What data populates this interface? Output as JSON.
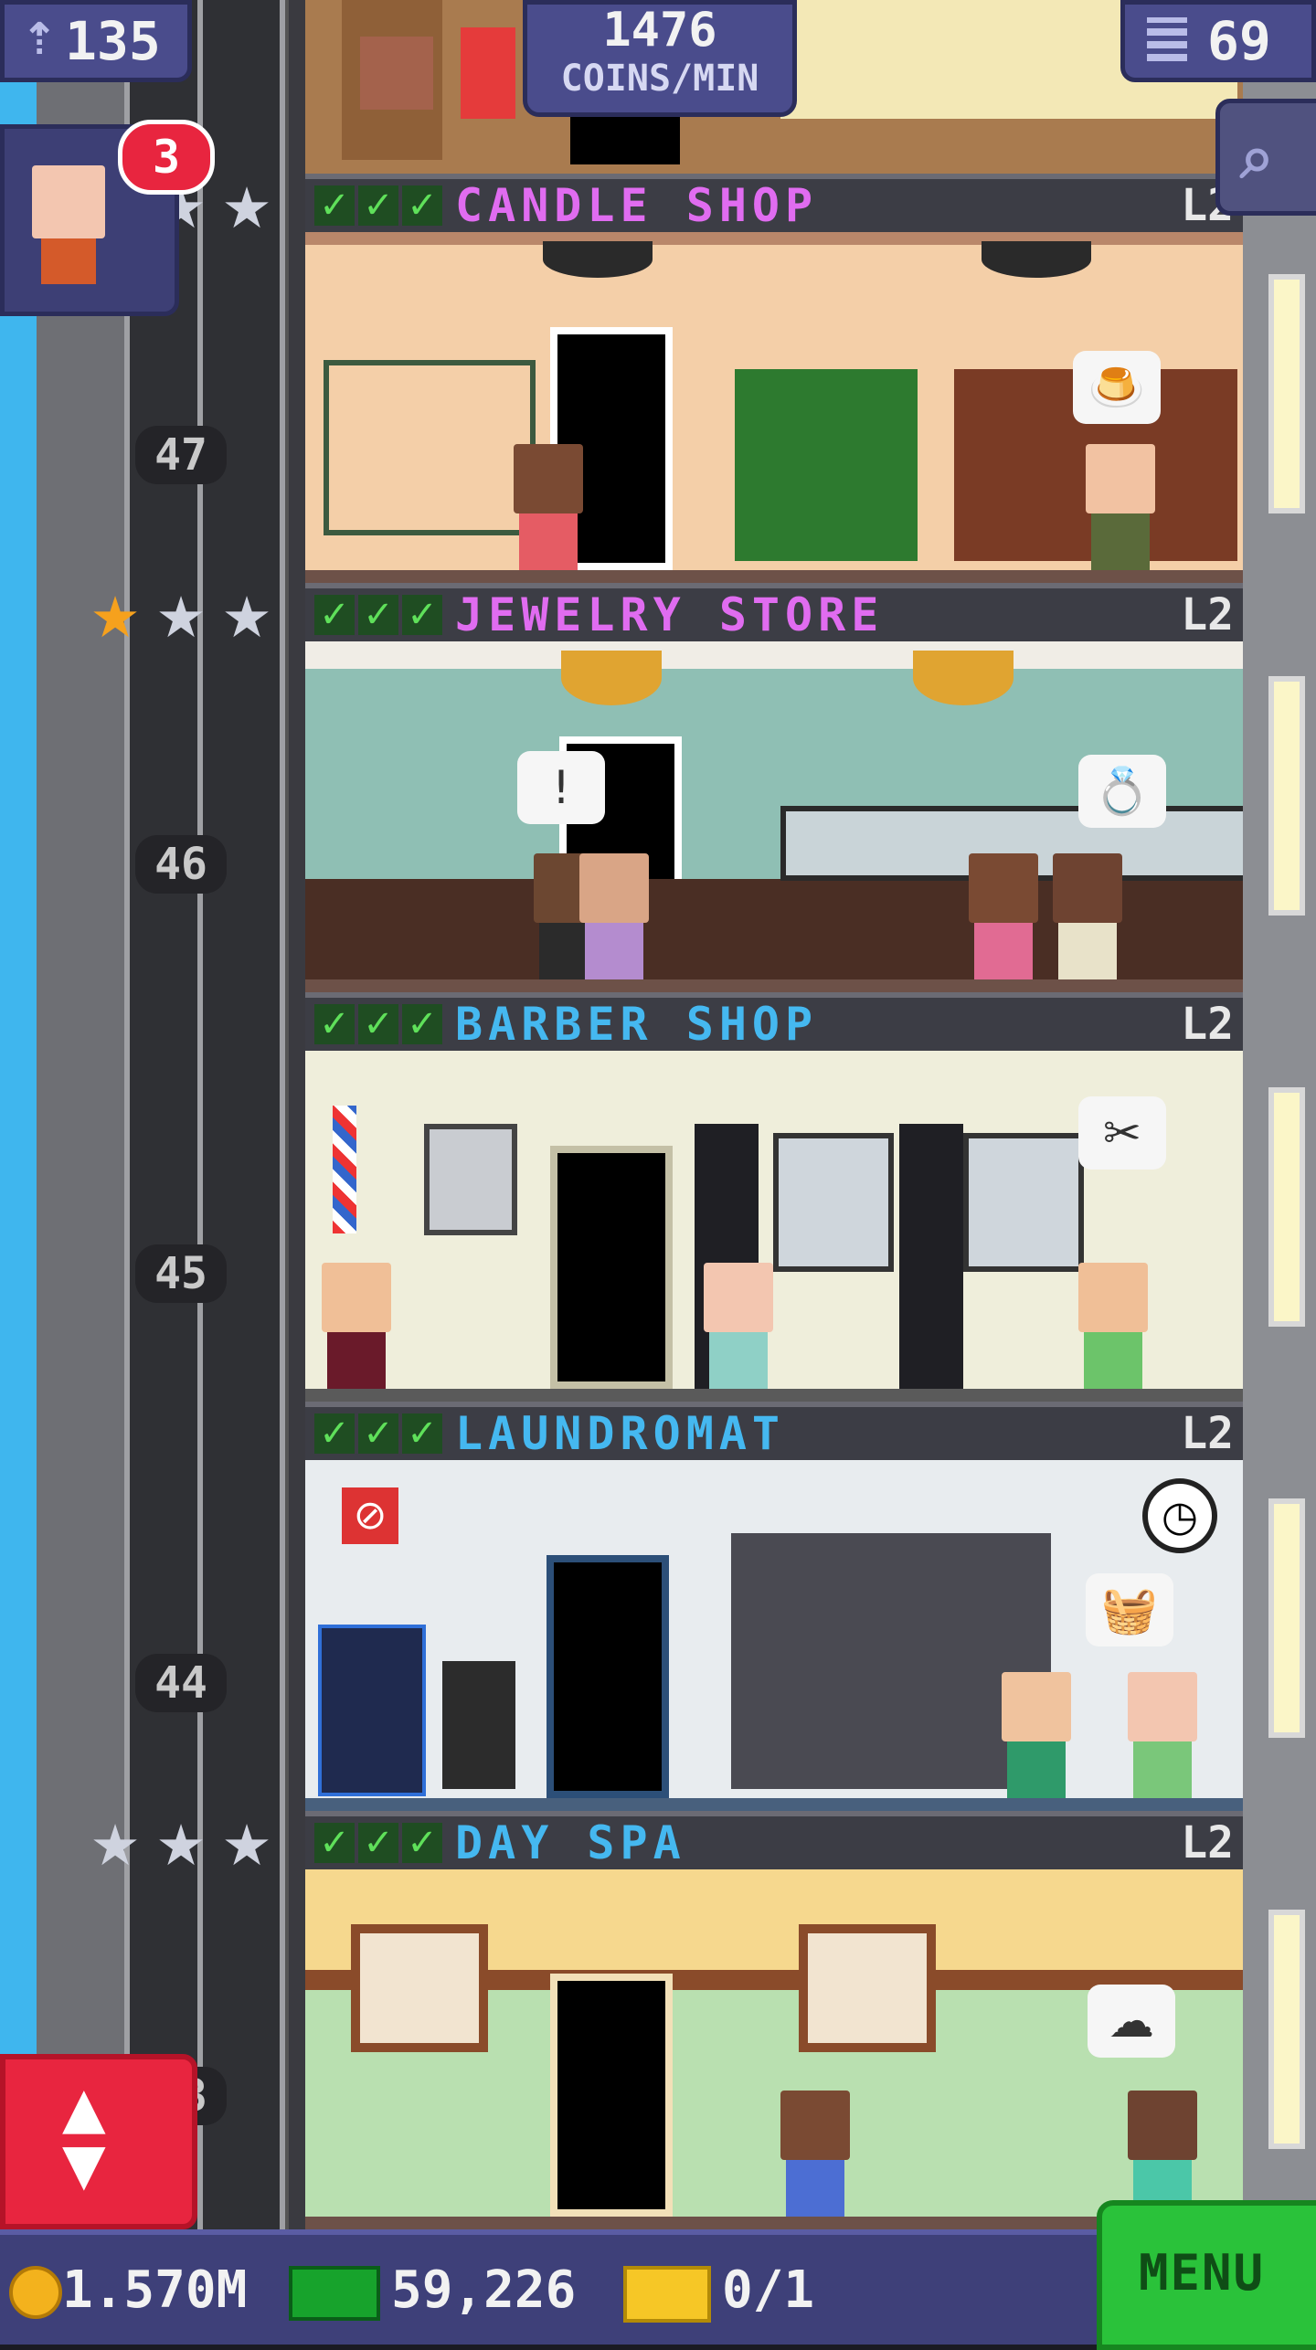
{
  "hud": {
    "population": "135",
    "coins_per_min_value": "1476",
    "coins_per_min_label": "COINS/MIN",
    "floors_count": "69",
    "notification_badge": "3"
  },
  "floors": [
    {
      "name": "CANDLE SHOP",
      "level": "L2",
      "number": "47"
    },
    {
      "name": "JEWELRY STORE",
      "level": "L2",
      "number": "46"
    },
    {
      "name": "BARBER SHOP",
      "level": "L2",
      "number": "45"
    },
    {
      "name": "LAUNDROMAT",
      "level": "L2",
      "number": "44"
    },
    {
      "name": "DAY SPA",
      "level": "L2",
      "number": "43"
    }
  ],
  "bottom_bar": {
    "coins": "1.570M",
    "bux": "59,226",
    "tickets": "0/1",
    "menu_label": "MENU"
  },
  "colors": {
    "candle_shop_name": "#e06cf0",
    "jewelry_store_name": "#e06cf0",
    "barber_shop_name": "#45b8f0",
    "laundromat_name": "#45b8f0",
    "day_spa_name": "#45b8f0",
    "menu_button": "#2ac23a",
    "elevator_button": "#e8253f"
  },
  "icons": {
    "population": "person-up-icon",
    "floors": "building-grid-icon",
    "search": "magnifier-icon",
    "coins": "coin-icon",
    "bux": "cash-icon",
    "tickets": "ticket-icon",
    "elevator": "up-down-arrows-icon"
  }
}
